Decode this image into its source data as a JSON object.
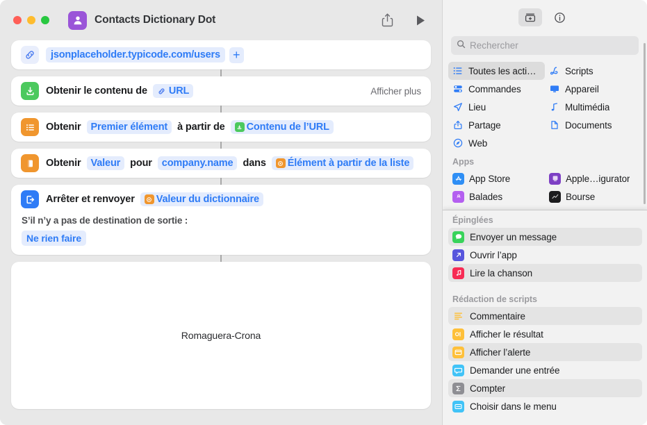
{
  "window": {
    "title": "Contacts Dictionary Dot",
    "app_icon": "contacts-person-icon",
    "accent": "#9a55d8"
  },
  "toolbar": {
    "share_label": "share-icon",
    "run_label": "run-play-icon"
  },
  "workflow": {
    "url_action": {
      "icon": "link-icon",
      "url": "jsonplaceholder.typicode.com/users",
      "add_label": "+"
    },
    "actions": [
      {
        "icon": "download-contents-icon",
        "icon_color": "#4cc95e",
        "prefix": "Obtenir le contenu de",
        "token": "URL",
        "token_icon": "link-icon",
        "trailing": "Afficher plus"
      },
      {
        "icon": "list-item-icon",
        "icon_color": "#f0962e",
        "prefix": "Obtenir",
        "param1": "Premier élément",
        "mid": "à partir de",
        "var_token": "Contenu de l’URL",
        "var_token_color": "#4cc95e"
      },
      {
        "icon": "dictionary-value-icon",
        "icon_color": "#f0962e",
        "prefix": "Obtenir",
        "param1": "Valeur",
        "mid1": "pour",
        "param2": "company.name",
        "mid2": "dans",
        "var_token": "Élément à partir de la liste",
        "var_token_color": "#f0962e"
      },
      {
        "icon": "stop-and-return-icon",
        "icon_color": "#2f7cf6",
        "prefix": "Arrêter et renvoyer",
        "var_token": "Valeur du dictionnaire",
        "var_token_color": "#f0962e",
        "sub_label": "S’il n’y a pas de destination de sortie :",
        "sub_option": "Ne rien faire"
      }
    ],
    "result": "Romaguera-Crona"
  },
  "sidebar": {
    "tabs": [
      {
        "name": "action-library-tab",
        "icon": "action-library-icon",
        "active": true
      },
      {
        "name": "info-tab",
        "icon": "info-circle-icon",
        "active": false
      }
    ],
    "search": {
      "placeholder": "Rechercher",
      "value": "",
      "icon": "search-icon"
    },
    "categories": [
      {
        "label": "Toutes les acti…",
        "icon": "list-bullet-icon",
        "selected": true
      },
      {
        "label": "Scripts",
        "icon": "scripts-icon",
        "selected": false
      },
      {
        "label": "Commandes",
        "icon": "controls-icon",
        "selected": false
      },
      {
        "label": "Appareil",
        "icon": "device-display-icon",
        "selected": false
      },
      {
        "label": "Lieu",
        "icon": "location-arrow-icon",
        "selected": false
      },
      {
        "label": "Multimédia",
        "icon": "music-note-icon",
        "selected": false
      },
      {
        "label": "Partage",
        "icon": "share-icon",
        "selected": false
      },
      {
        "label": "Documents",
        "icon": "document-page-icon",
        "selected": false
      },
      {
        "label": "Web",
        "icon": "safari-compass-icon",
        "selected": false
      }
    ],
    "apps_header": "Apps",
    "apps": [
      {
        "label": "App Store",
        "icon": "app-store-icon",
        "color": "#2f8ff5"
      },
      {
        "label": "Apple…igurator",
        "icon": "apple-configurator-icon",
        "color": "#7d3fc4"
      },
      {
        "label": "Balades",
        "icon": "podcasts-icon",
        "color": "#b45ff0"
      },
      {
        "label": "Bourse",
        "icon": "stocks-icon",
        "color": "#1c1c1e"
      }
    ],
    "pinned_header": "Épinglées",
    "pinned": [
      {
        "label": "Envoyer un message",
        "icon": "messages-icon",
        "color": "#38d35a",
        "alt": true
      },
      {
        "label": "Ouvrir l’app",
        "icon": "open-app-arrow-icon",
        "color": "#5856dd",
        "alt": false
      },
      {
        "label": "Lire la chanson",
        "icon": "music-play-icon",
        "color": "#f72b54",
        "alt": true
      }
    ],
    "scripting_header": "Rédaction de scripts",
    "scripting": [
      {
        "label": "Commentaire",
        "icon": "comment-lines-icon",
        "color": "#fec03a",
        "alt": true
      },
      {
        "label": "Afficher le résultat",
        "icon": "show-result-icon",
        "color": "#fec03a",
        "alt": false
      },
      {
        "label": "Afficher l’alerte",
        "icon": "show-alert-icon",
        "color": "#fec03a",
        "alt": true
      },
      {
        "label": "Demander une entrée",
        "icon": "ask-input-icon",
        "color": "#41c3f7",
        "alt": false
      },
      {
        "label": "Compter",
        "icon": "count-sigma-icon",
        "color": "#8e8e93",
        "alt": true
      },
      {
        "label": "Choisir dans le menu",
        "icon": "choose-menu-icon",
        "color": "#41c3f7",
        "alt": false
      }
    ]
  }
}
